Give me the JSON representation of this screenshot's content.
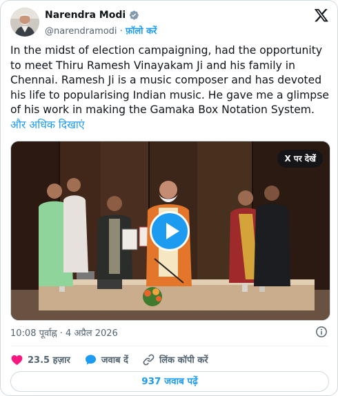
{
  "author": {
    "name": "Narendra Modi",
    "handle": "@narendramodi",
    "separator": "·",
    "follow_label": "फ़ॉलो करें",
    "verified": true
  },
  "tweet": {
    "text": "In the midst of election campaigning, had the opportunity to meet Thiru Ramesh Vinayakam Ji and his family in Chennai. Ramesh Ji is a music composer and has devoted his life to popularising Indian music. He gave me a glimpse of his work in making the Gamaka Box Notation System.",
    "more_label": "और अधिक दिखाएं"
  },
  "media": {
    "type": "video",
    "watch_on_x_label": "X पर देखें"
  },
  "timestamp": "10:08 पूर्वाह्न · 4 अप्रैल 2026",
  "actions": {
    "like_count": "23.5 हज़ार",
    "reply_label": "जवाब दें",
    "copy_link_label": "लिंक कॉपी करें"
  },
  "read_replies_label": "937 जवाब पढ़ें",
  "icons": {
    "verified": "verified-badge-icon",
    "x_logo": "x-logo-icon",
    "play": "play-icon",
    "info": "info-icon",
    "heart": "heart-icon",
    "reply": "reply-bubble-icon",
    "link": "link-icon"
  },
  "colors": {
    "accent": "#1d9bf0",
    "like": "#f91880",
    "text": "#0f1419",
    "muted": "#536471",
    "border": "#cfd9de"
  }
}
